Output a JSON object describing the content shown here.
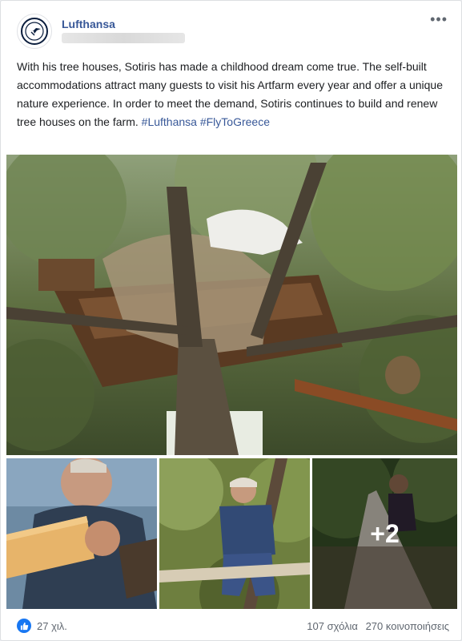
{
  "post": {
    "page_name": "Lufthansa",
    "text": "With his tree houses, Sotiris has made a childhood dream come true. The self-built accommodations attract many guests to visit his Artfarm every year and offer a unique nature experience. In order to meet the demand, Sotiris continues to build and renew tree houses on the farm.",
    "hashtags": [
      "#Lufthansa",
      "#FlyToGreece"
    ]
  },
  "photos": {
    "more_count": "+2"
  },
  "footer": {
    "reactions": "27 χιλ.",
    "comments": "107 σχόλια",
    "shares": "270 κοινοποιήσεις"
  },
  "icons": {
    "avatar": "lufthansa-crane-logo",
    "more": "more-dots-icon",
    "like": "thumbs-up-icon"
  },
  "colors": {
    "link": "#385898",
    "like_blue": "#1877f2",
    "text": "#1c1e21",
    "meta": "#606770"
  }
}
